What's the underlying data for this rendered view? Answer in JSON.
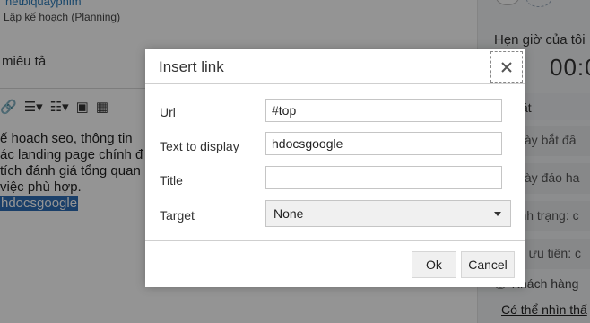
{
  "background": {
    "link_text": "hetbiquayphim",
    "planning_label": "Lập kế hoạch (Planning)",
    "description_label": "miêu tả",
    "editor_lines": [
      "ế hoạch seo, thông tin",
      "ác landing page chính đ",
      "tích đánh giá tổng quan",
      "việc phù hợp."
    ],
    "selected_text": "hdocsgoogle",
    "right_panel": {
      "timer_title": "Hẹn giờ của tôi",
      "timer_value": "00:0",
      "section_label": "ặt",
      "start_date_label": "Ngày bắt đầ",
      "due_date_label": "Ngày đáo ha",
      "status_label": "Tình trạng: c",
      "priority_label": "Sự ưu tiên: c",
      "visibility_label": "Khách hàng",
      "visibility_link": "Có thể nhìn thấ"
    }
  },
  "dialog": {
    "title": "Insert link",
    "fields": {
      "url": {
        "label": "Url",
        "value": "#top"
      },
      "text": {
        "label": "Text to display",
        "value": "hdocsgoogle"
      },
      "title": {
        "label": "Title",
        "value": ""
      },
      "target": {
        "label": "Target",
        "value": "None"
      }
    },
    "buttons": {
      "ok": "Ok",
      "cancel": "Cancel"
    }
  },
  "icons": {
    "close": "close-icon",
    "eye": "eye-icon",
    "caret": "chevron-down-icon"
  },
  "colors": {
    "selection": "#2d6db6",
    "overlay": "rgba(0,0,0,0.42)"
  }
}
